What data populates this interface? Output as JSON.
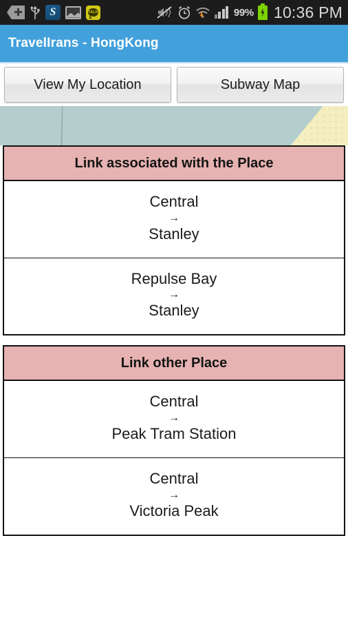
{
  "status_bar": {
    "icons": [
      {
        "name": "download-badge-icon",
        "glyph": "download"
      },
      {
        "name": "usb-icon",
        "glyph": "usb"
      },
      {
        "name": "skype-icon",
        "glyph": "S"
      },
      {
        "name": "gallery-icon",
        "glyph": "image"
      },
      {
        "name": "kakaotalk-icon",
        "glyph": "TALK"
      },
      {
        "name": "sound-mute-vibrate-icon",
        "glyph": "mute"
      },
      {
        "name": "alarm-clock-icon",
        "glyph": "alarm"
      },
      {
        "name": "wifi-download-icon",
        "glyph": "wifi"
      },
      {
        "name": "cellular-signal-icon",
        "glyph": "signal"
      }
    ],
    "skype_letter": "S",
    "talk_label": "TALK",
    "battery_percent": "99%",
    "battery_state": "charging",
    "time": "10:36 PM"
  },
  "app_bar": {
    "title": "TravelIrans - HongKong",
    "background_color": "#42a0da"
  },
  "action_buttons": [
    {
      "label": "View My Location",
      "name": "view-my-location-button"
    },
    {
      "label": "Subway Map",
      "name": "subway-map-button"
    }
  ],
  "map_preview": {
    "water_color": "#b4cecd",
    "park_color": "#f4eec0"
  },
  "arrow_glyph": "→",
  "sections": [
    {
      "header": "Link associated with the Place",
      "header_color": "#e7b2b2",
      "rows": [
        {
          "from": "Central",
          "to": "Stanley"
        },
        {
          "from": "Repulse Bay",
          "to": "Stanley"
        }
      ]
    },
    {
      "header": "Link other Place",
      "header_color": "#e7b2b2",
      "rows": [
        {
          "from": "Central",
          "to": "Peak Tram Station"
        },
        {
          "from": "Central",
          "to": "Victoria Peak"
        }
      ]
    }
  ]
}
